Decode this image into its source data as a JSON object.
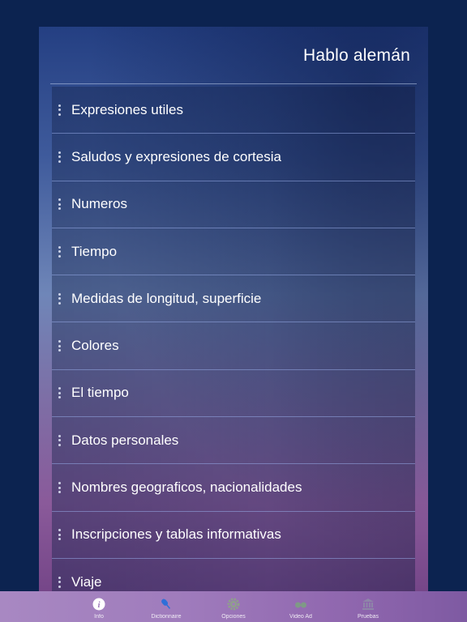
{
  "header": {
    "title": "Hablo alemán"
  },
  "list": {
    "items": [
      {
        "label": "Expresiones utiles"
      },
      {
        "label": "Saludos y expresiones de cortesia"
      },
      {
        "label": "Numeros"
      },
      {
        "label": "Tiempo"
      },
      {
        "label": "Medidas de longitud, superficie"
      },
      {
        "label": "Colores"
      },
      {
        "label": "El tiempo"
      },
      {
        "label": "Datos personales"
      },
      {
        "label": "Nombres geograficos, nacionalidades"
      },
      {
        "label": "Inscripciones y tablas informativas"
      },
      {
        "label": "Viaje"
      }
    ]
  },
  "tabbar": {
    "tabs": [
      {
        "label": "Info",
        "icon": "info-icon"
      },
      {
        "label": "Dictionnaire",
        "icon": "microphone-icon"
      },
      {
        "label": "Opciones",
        "icon": "gear-icon"
      },
      {
        "label": "Video Ad",
        "icon": "video-icon"
      },
      {
        "label": "Pruebas",
        "icon": "bank-icon"
      }
    ]
  },
  "colors": {
    "background": "#0c2350",
    "tabbar": "#9f7bbc",
    "text": "#ffffff"
  }
}
